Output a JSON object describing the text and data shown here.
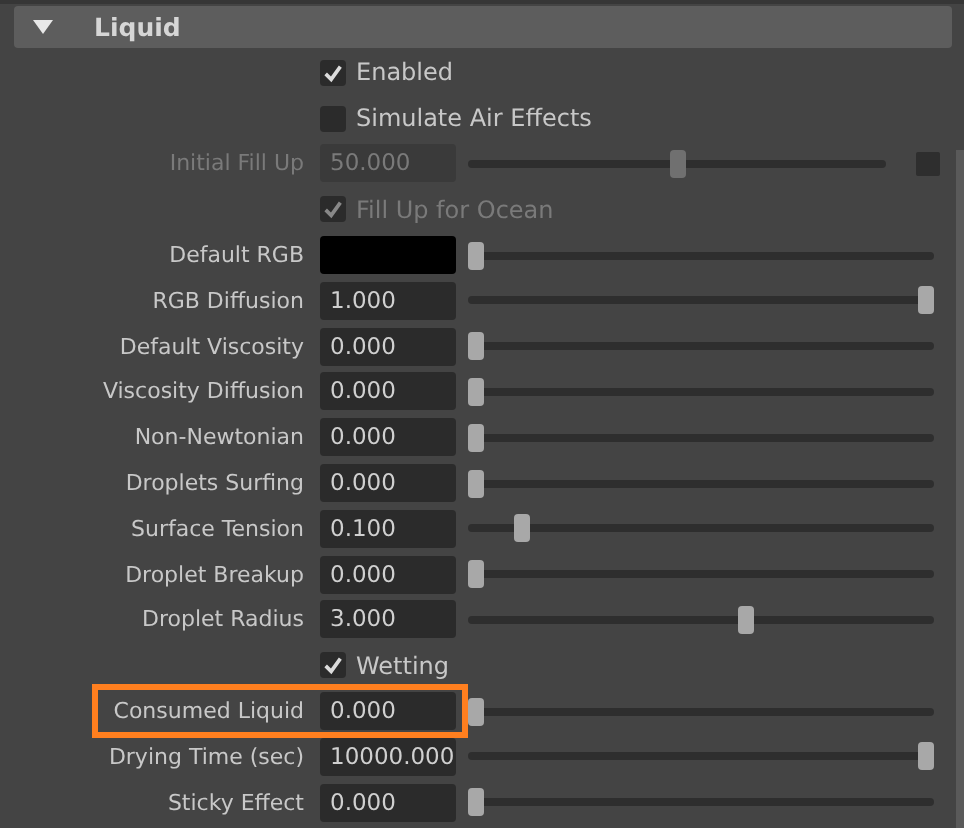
{
  "section": {
    "title": "Liquid",
    "expanded": true
  },
  "rows": [
    {
      "kind": "checkbox",
      "label": "Enabled",
      "checked": true,
      "disabled": false,
      "highlighted": false
    },
    {
      "kind": "checkbox",
      "label": "Simulate Air Effects",
      "checked": false,
      "disabled": false,
      "highlighted": false
    },
    {
      "kind": "slider",
      "label": "Initial Fill Up",
      "value": "50.000",
      "level": 0.5,
      "disabled": true,
      "highlighted": false,
      "swatch": true
    },
    {
      "kind": "checkbox",
      "label": "Fill Up for Ocean",
      "checked": true,
      "disabled": true,
      "highlighted": false
    },
    {
      "kind": "color",
      "label": "Default RGB",
      "color": "#000000",
      "level": 0,
      "disabled": false,
      "highlighted": false
    },
    {
      "kind": "slider",
      "label": "RGB Diffusion",
      "value": "1.000",
      "level": 1,
      "disabled": false,
      "highlighted": false
    },
    {
      "kind": "slider",
      "label": "Default Viscosity",
      "value": "0.000",
      "level": 0,
      "disabled": false,
      "highlighted": false
    },
    {
      "kind": "slider",
      "label": "Viscosity Diffusion",
      "value": "0.000",
      "level": 0,
      "disabled": false,
      "highlighted": false
    },
    {
      "kind": "slider",
      "label": "Non-Newtonian",
      "value": "0.000",
      "level": 0,
      "disabled": false,
      "highlighted": false
    },
    {
      "kind": "slider",
      "label": "Droplets Surfing",
      "value": "0.000",
      "level": 0,
      "disabled": false,
      "highlighted": false
    },
    {
      "kind": "slider",
      "label": "Surface Tension",
      "value": "0.100",
      "level": 0.1,
      "disabled": false,
      "highlighted": false
    },
    {
      "kind": "slider",
      "label": "Droplet Breakup",
      "value": "0.000",
      "level": 0,
      "disabled": false,
      "highlighted": false
    },
    {
      "kind": "slider",
      "label": "Droplet Radius",
      "value": "3.000",
      "level": 0.6,
      "disabled": false,
      "highlighted": false
    },
    {
      "kind": "checkbox",
      "label": "Wetting",
      "checked": true,
      "disabled": false,
      "highlighted": false
    },
    {
      "kind": "slider",
      "label": "Consumed Liquid",
      "value": "0.000",
      "level": 0,
      "disabled": false,
      "highlighted": true
    },
    {
      "kind": "slider",
      "label": "Drying Time (sec)",
      "value": "10000.000",
      "level": 1,
      "disabled": false,
      "highlighted": false
    },
    {
      "kind": "slider",
      "label": "Sticky Effect",
      "value": "0.000",
      "level": 0,
      "disabled": false,
      "highlighted": false
    }
  ]
}
